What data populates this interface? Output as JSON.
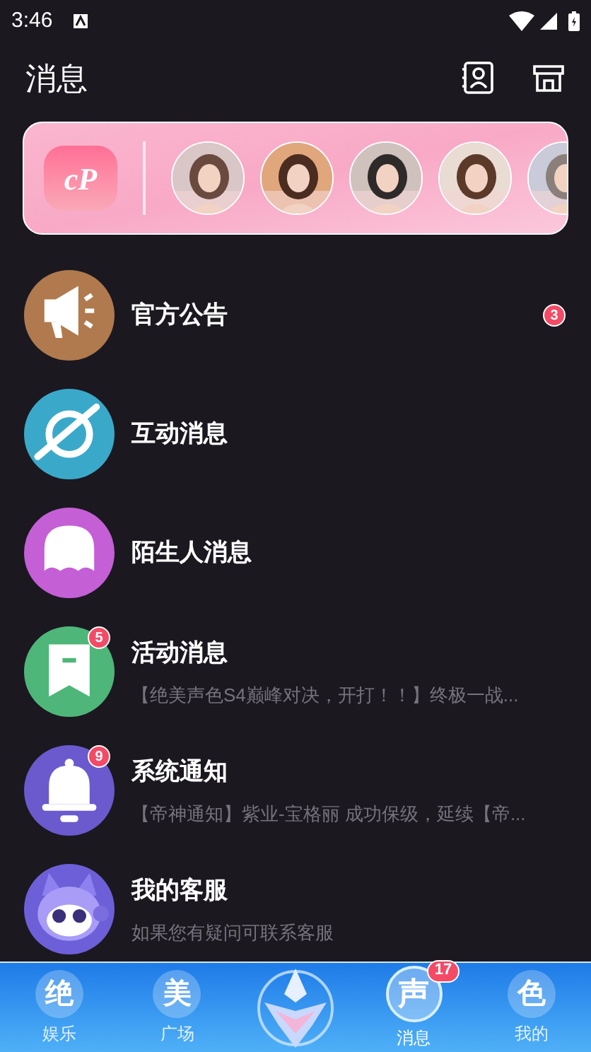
{
  "status_bar": {
    "time": "3:46"
  },
  "header": {
    "title": "消息"
  },
  "cp_banner": {
    "logo": "cP"
  },
  "messages": [
    {
      "kind": "megaphone",
      "color": "#b07a4e",
      "title": "官方公告",
      "badge": "3"
    },
    {
      "kind": "planet",
      "color": "#3aa9c9",
      "title": "互动消息"
    },
    {
      "kind": "ghost",
      "color": "#c45fd6",
      "title": "陌生人消息"
    },
    {
      "kind": "bookmark",
      "color": "#4fb67a",
      "title": "活动消息",
      "subtitle": "【绝美声色S4巅峰对决，开打！！】终极一战...",
      "badge": "5"
    },
    {
      "kind": "bell",
      "color": "#6a5acd",
      "title": "系统通知",
      "subtitle": "【帝神通知】紫业-宝格丽 成功保级，延续【帝...",
      "badge": "9"
    },
    {
      "kind": "robot",
      "color": "#6d5fd8",
      "title": "我的客服",
      "subtitle": "如果您有疑问可联系客服"
    }
  ],
  "bottom_nav": {
    "tabs": [
      {
        "glyph": "绝",
        "label": "娱乐",
        "selected": false
      },
      {
        "glyph": "美",
        "label": "广场",
        "selected": false
      },
      {
        "kind": "emblem"
      },
      {
        "glyph": "声",
        "label": "消息",
        "selected": true,
        "badge": "17"
      },
      {
        "glyph": "色",
        "label": "我的",
        "selected": false
      }
    ]
  }
}
